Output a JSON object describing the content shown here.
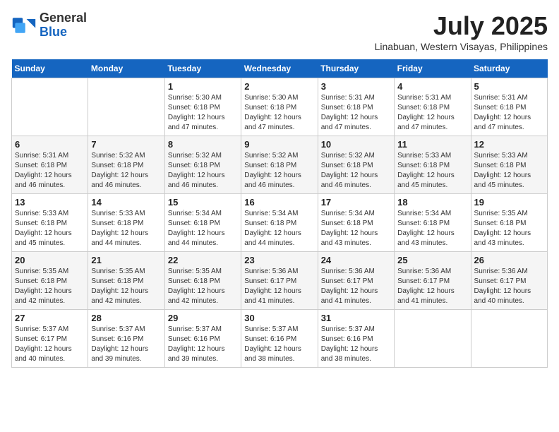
{
  "header": {
    "logo_line1": "General",
    "logo_line2": "Blue",
    "title": "July 2025",
    "subtitle": "Linabuan, Western Visayas, Philippines"
  },
  "days_of_week": [
    "Sunday",
    "Monday",
    "Tuesday",
    "Wednesday",
    "Thursday",
    "Friday",
    "Saturday"
  ],
  "weeks": [
    [
      {
        "day": "",
        "info": ""
      },
      {
        "day": "",
        "info": ""
      },
      {
        "day": "1",
        "info": "Sunrise: 5:30 AM\nSunset: 6:18 PM\nDaylight: 12 hours and 47 minutes."
      },
      {
        "day": "2",
        "info": "Sunrise: 5:30 AM\nSunset: 6:18 PM\nDaylight: 12 hours and 47 minutes."
      },
      {
        "day": "3",
        "info": "Sunrise: 5:31 AM\nSunset: 6:18 PM\nDaylight: 12 hours and 47 minutes."
      },
      {
        "day": "4",
        "info": "Sunrise: 5:31 AM\nSunset: 6:18 PM\nDaylight: 12 hours and 47 minutes."
      },
      {
        "day": "5",
        "info": "Sunrise: 5:31 AM\nSunset: 6:18 PM\nDaylight: 12 hours and 47 minutes."
      }
    ],
    [
      {
        "day": "6",
        "info": "Sunrise: 5:31 AM\nSunset: 6:18 PM\nDaylight: 12 hours and 46 minutes."
      },
      {
        "day": "7",
        "info": "Sunrise: 5:32 AM\nSunset: 6:18 PM\nDaylight: 12 hours and 46 minutes."
      },
      {
        "day": "8",
        "info": "Sunrise: 5:32 AM\nSunset: 6:18 PM\nDaylight: 12 hours and 46 minutes."
      },
      {
        "day": "9",
        "info": "Sunrise: 5:32 AM\nSunset: 6:18 PM\nDaylight: 12 hours and 46 minutes."
      },
      {
        "day": "10",
        "info": "Sunrise: 5:32 AM\nSunset: 6:18 PM\nDaylight: 12 hours and 46 minutes."
      },
      {
        "day": "11",
        "info": "Sunrise: 5:33 AM\nSunset: 6:18 PM\nDaylight: 12 hours and 45 minutes."
      },
      {
        "day": "12",
        "info": "Sunrise: 5:33 AM\nSunset: 6:18 PM\nDaylight: 12 hours and 45 minutes."
      }
    ],
    [
      {
        "day": "13",
        "info": "Sunrise: 5:33 AM\nSunset: 6:18 PM\nDaylight: 12 hours and 45 minutes."
      },
      {
        "day": "14",
        "info": "Sunrise: 5:33 AM\nSunset: 6:18 PM\nDaylight: 12 hours and 44 minutes."
      },
      {
        "day": "15",
        "info": "Sunrise: 5:34 AM\nSunset: 6:18 PM\nDaylight: 12 hours and 44 minutes."
      },
      {
        "day": "16",
        "info": "Sunrise: 5:34 AM\nSunset: 6:18 PM\nDaylight: 12 hours and 44 minutes."
      },
      {
        "day": "17",
        "info": "Sunrise: 5:34 AM\nSunset: 6:18 PM\nDaylight: 12 hours and 43 minutes."
      },
      {
        "day": "18",
        "info": "Sunrise: 5:34 AM\nSunset: 6:18 PM\nDaylight: 12 hours and 43 minutes."
      },
      {
        "day": "19",
        "info": "Sunrise: 5:35 AM\nSunset: 6:18 PM\nDaylight: 12 hours and 43 minutes."
      }
    ],
    [
      {
        "day": "20",
        "info": "Sunrise: 5:35 AM\nSunset: 6:18 PM\nDaylight: 12 hours and 42 minutes."
      },
      {
        "day": "21",
        "info": "Sunrise: 5:35 AM\nSunset: 6:18 PM\nDaylight: 12 hours and 42 minutes."
      },
      {
        "day": "22",
        "info": "Sunrise: 5:35 AM\nSunset: 6:18 PM\nDaylight: 12 hours and 42 minutes."
      },
      {
        "day": "23",
        "info": "Sunrise: 5:36 AM\nSunset: 6:17 PM\nDaylight: 12 hours and 41 minutes."
      },
      {
        "day": "24",
        "info": "Sunrise: 5:36 AM\nSunset: 6:17 PM\nDaylight: 12 hours and 41 minutes."
      },
      {
        "day": "25",
        "info": "Sunrise: 5:36 AM\nSunset: 6:17 PM\nDaylight: 12 hours and 41 minutes."
      },
      {
        "day": "26",
        "info": "Sunrise: 5:36 AM\nSunset: 6:17 PM\nDaylight: 12 hours and 40 minutes."
      }
    ],
    [
      {
        "day": "27",
        "info": "Sunrise: 5:37 AM\nSunset: 6:17 PM\nDaylight: 12 hours and 40 minutes."
      },
      {
        "day": "28",
        "info": "Sunrise: 5:37 AM\nSunset: 6:16 PM\nDaylight: 12 hours and 39 minutes."
      },
      {
        "day": "29",
        "info": "Sunrise: 5:37 AM\nSunset: 6:16 PM\nDaylight: 12 hours and 39 minutes."
      },
      {
        "day": "30",
        "info": "Sunrise: 5:37 AM\nSunset: 6:16 PM\nDaylight: 12 hours and 38 minutes."
      },
      {
        "day": "31",
        "info": "Sunrise: 5:37 AM\nSunset: 6:16 PM\nDaylight: 12 hours and 38 minutes."
      },
      {
        "day": "",
        "info": ""
      },
      {
        "day": "",
        "info": ""
      }
    ]
  ]
}
